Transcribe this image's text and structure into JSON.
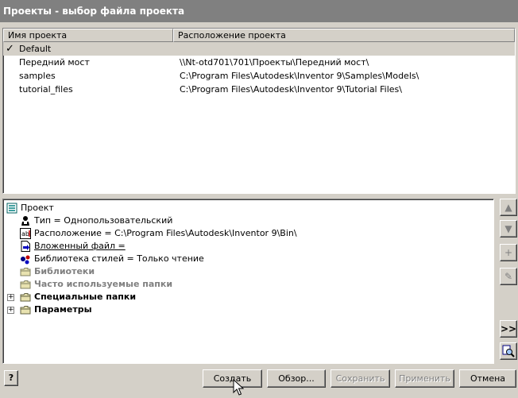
{
  "window": {
    "title": "Проекты - выбор файла проекта"
  },
  "projects": {
    "columns": [
      "Имя проекта",
      "Расположение проекта"
    ],
    "rows": [
      {
        "name": "Default",
        "location": "",
        "active": true
      },
      {
        "name": "Передний мост",
        "location": "\\\\Nt-otd701\\701\\Проекты\\Передний мост\\"
      },
      {
        "name": "samples",
        "location": "C:\\Program Files\\Autodesk\\Inventor 9\\Samples\\Models\\"
      },
      {
        "name": "tutorial_files",
        "location": "C:\\Program Files\\Autodesk\\Inventor 9\\Tutorial Files\\"
      }
    ]
  },
  "tree": {
    "root": "Проект",
    "type": "Тип = Однопользовательский",
    "location": "Расположение = C:\\Program Files\\Autodesk\\Inventor 9\\Bin\\",
    "included_file": "Вложенный файл = ",
    "style_library": "Библиотека стилей = Только чтение",
    "libraries": "Библиотеки",
    "frequent_folders": "Часто используемые папки",
    "special_folders": "Специальные папки",
    "parameters": "Параметры"
  },
  "side_buttons": {
    "up": "▲",
    "down": "▼",
    "add": "+",
    "edit": "✎",
    "expand": ">>"
  },
  "buttons": {
    "help": "?",
    "create": "Создать",
    "browse": "Обзор...",
    "save": "Сохранить",
    "apply": "Применить",
    "cancel": "Отмена"
  },
  "colors": {
    "titlebar": "#808080",
    "face": "#d4d0c8"
  }
}
